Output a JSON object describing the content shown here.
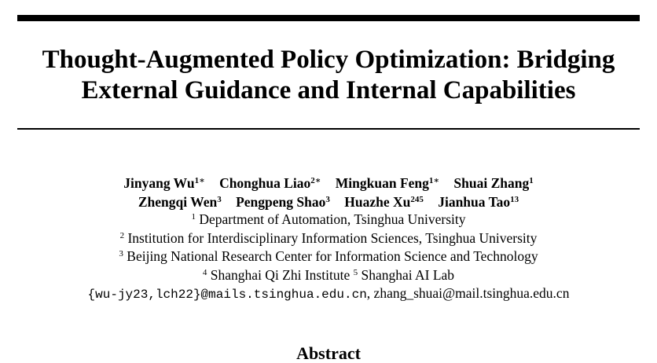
{
  "paper": {
    "title_line1": "Thought-Augmented Policy Optimization: Bridging",
    "title_line2": "External Guidance and Internal Capabilities",
    "authors": [
      {
        "name": "Jinyang Wu",
        "sup": "1∗"
      },
      {
        "name": "Chonghua Liao",
        "sup": "2∗"
      },
      {
        "name": "Mingkuan Feng",
        "sup": "1∗"
      },
      {
        "name": "Shuai Zhang",
        "sup": "1"
      },
      {
        "name": "Zhengqi Wen",
        "sup": "3"
      },
      {
        "name": "Pengpeng Shao",
        "sup": "3"
      },
      {
        "name": "Huazhe Xu",
        "sup": "245"
      },
      {
        "name": "Jianhua Tao",
        "sup": "13"
      }
    ],
    "affiliations": [
      {
        "sup": "1",
        "text": "Department of Automation, Tsinghua University"
      },
      {
        "sup": "2",
        "text": "Institution for Interdisciplinary Information Sciences, Tsinghua University"
      },
      {
        "sup": "3",
        "text": "Beijing National Research Center for Information Science and Technology"
      },
      {
        "sup": "4",
        "text": "Shanghai Qi Zhi Institute"
      },
      {
        "sup": "5",
        "text": "Shanghai AI Lab"
      }
    ],
    "emails_mono": "{wu-jy23,lch22}@mails.tsinghua.edu.cn",
    "emails_separator": ", ",
    "emails_plain": "zhang_shuai@mail.tsinghua.edu.cn",
    "abstract_heading": "Abstract"
  }
}
